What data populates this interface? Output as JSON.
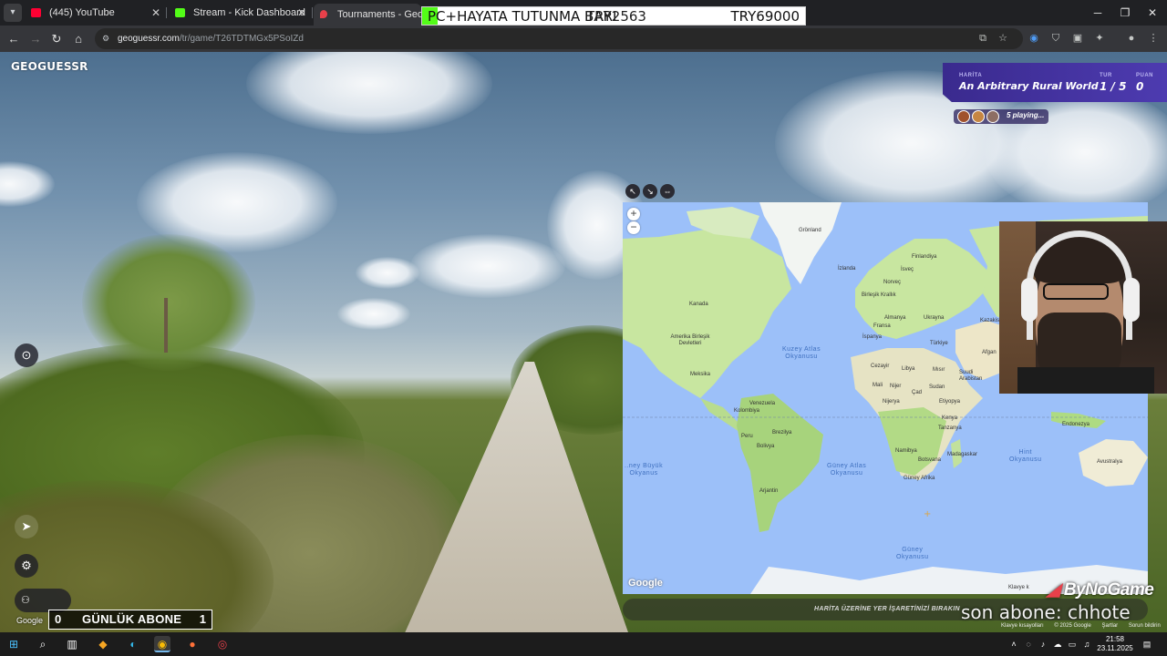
{
  "browser": {
    "tabs": [
      {
        "title": "(445) YouTube",
        "color": "#ff0033"
      },
      {
        "title": "Stream - Kick Dashboard",
        "color": "#53fc18"
      },
      {
        "title": "Tournaments - GeoGuessr",
        "color": "#e8404a"
      }
    ],
    "url_host": "geoguessr.com",
    "url_path": "/tr/game/T26TDTMGx5PSoIZd"
  },
  "goal": {
    "label": "PC+HAYATA TUTUNMA BARI",
    "current": "TRY2563",
    "target": "TRY69000",
    "progress": 0.037
  },
  "game": {
    "logo": "GEOGUESSR",
    "map_label": "HARİTA",
    "map_name": "An Arbitrary Rural World",
    "round_label": "TUR",
    "round": "1 / 5",
    "score_label": "PUAN",
    "score": "0",
    "players": "5 playing...",
    "place_hint": "HARİTA ÜZERİNE YER İŞARETİNİZİ BIRAKIN",
    "google": "Google"
  },
  "map": {
    "google": "Google",
    "keyboard": "Klavye k",
    "ocean_labels": {
      "north_atlantic": [
        "Kuzey Atlas",
        "Okyanusu"
      ],
      "south_pacific": [
        "..ney Büyük",
        "Okyanus"
      ],
      "south_atlantic": [
        "Güney Atlas",
        "Okyanusu"
      ],
      "indian": [
        "Hint",
        "Okyanusu"
      ],
      "southern": [
        "Güney",
        "Okyanusu"
      ]
    },
    "countries": [
      "Grönland",
      "Kanada",
      "Amerika Birleşik Devletleri",
      "Meksika",
      "Venezuela",
      "Kolombiya",
      "Peru",
      "Brezilya",
      "Bolivya",
      "Arjantin",
      "İzlanda",
      "Finlandiya",
      "İsveç",
      "Norveç",
      "Birleşik Krallık",
      "Almanya",
      "Fransa",
      "Ukrayna",
      "Kazakis",
      "İspanya",
      "Türkiye",
      "Cezayir",
      "Libya",
      "Mısır",
      "Afgan",
      "Suudi Arabistan",
      "Mali",
      "Nijer",
      "Çad",
      "Sudan",
      "Nijerya",
      "Etiyopya",
      "Kenya",
      "Tanzanya",
      "Namibya",
      "Botsvana",
      "Madagaskar",
      "Güney Afrika",
      "Endonezya",
      "Avustralya"
    ]
  },
  "overlay": {
    "sub_left": "0",
    "sub_label": "GÜNLÜK ABONE",
    "sub_right": "1",
    "brand": "ByNoGame",
    "son_abone": "son abone: chhote"
  },
  "attribution": {
    "keyboard": "Klavye kısayolları",
    "copyright": "© 2025 Google",
    "terms": "Şartlar",
    "report": "Sorun bildirin"
  },
  "taskbar": {
    "time": "21:58",
    "date": "23.11.2025"
  }
}
